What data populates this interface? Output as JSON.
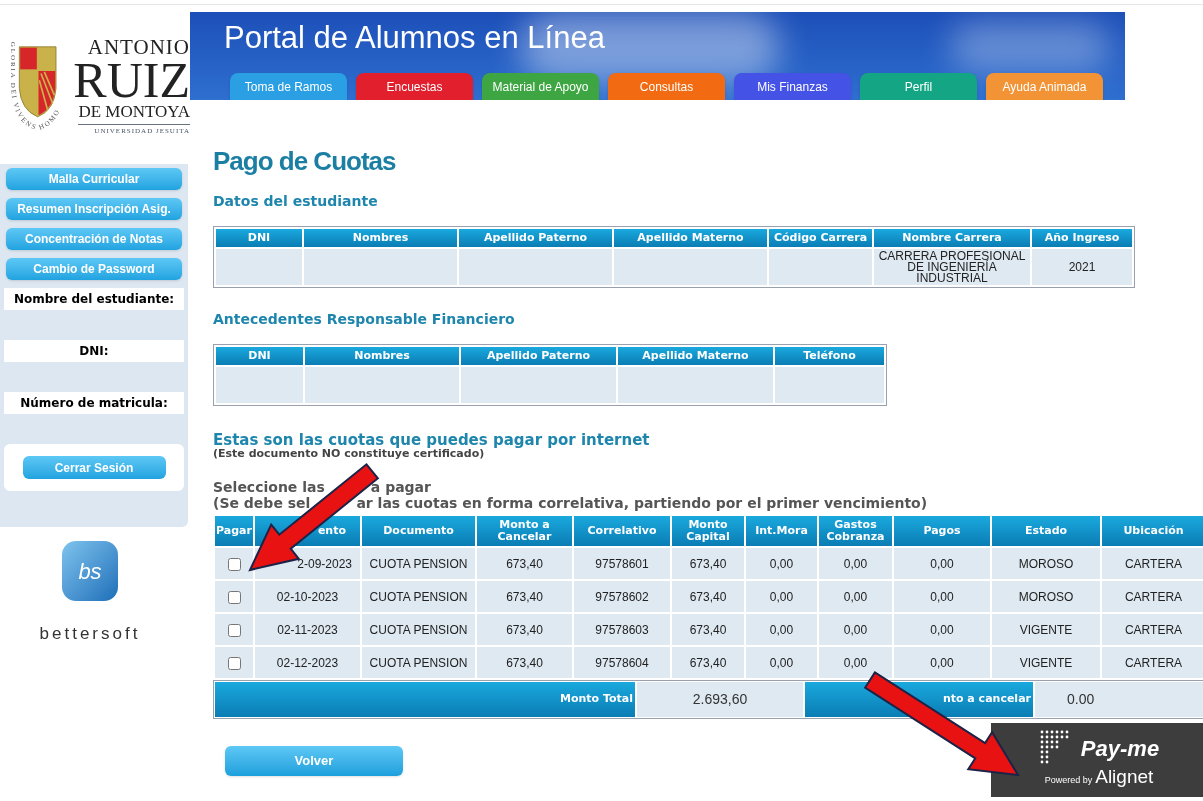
{
  "logo": {
    "motto": "GLORIA DEI VIVENS HOMO",
    "name_line_1": "ANTONIO",
    "name_line_2": "RUIZ",
    "name_line_3": "DE MONTOYA",
    "subtitle": "UNIVERSIDAD JESUITA"
  },
  "header": {
    "title": "Portal de Alumnos en Línea",
    "tabs": [
      {
        "label": "Toma de Ramos",
        "color": "#2b9fe3"
      },
      {
        "label": "Encuestas",
        "color": "#e11f2d"
      },
      {
        "label": "Material de Apoyo",
        "color": "#3da643"
      },
      {
        "label": "Consultas",
        "color": "#f26b12"
      },
      {
        "label": "Mis Finanzas",
        "color": "#4452e6"
      },
      {
        "label": "Perfil",
        "color": "#14a585"
      },
      {
        "label": "Ayuda Animada",
        "color": "#f29436"
      }
    ]
  },
  "sidebar": {
    "buttons": [
      "Malla Curricular",
      "Resumen Inscripción Asig.",
      "Concentración de Notas",
      "Cambio de Password"
    ],
    "fields": [
      {
        "label": "Nombre del estudiante:"
      },
      {
        "label": "DNI:"
      },
      {
        "label": "Número de matricula:"
      }
    ],
    "logout_button": "Cerrar Sesión"
  },
  "vendor_logo": {
    "cube_text": "bs",
    "name": "bettersoft"
  },
  "page_title": "Pago de Cuotas",
  "student_section": {
    "heading": "Datos del estudiante",
    "table": {
      "columns": [
        "DNI",
        "Nombres",
        "Apellido Paterno",
        "Apellido Materno",
        "Código Carrera",
        "Nombre Carrera",
        "Año Ingreso"
      ],
      "rows": [
        [
          "",
          "",
          "",
          "",
          "",
          "CARRERA PROFESIONAL DE INGENIERÍA INDUSTRIAL",
          "2021"
        ]
      ]
    }
  },
  "financial_section": {
    "heading": "Antecedentes Responsable Financiero",
    "table": {
      "columns": [
        "DNI",
        "Nombres",
        "Apellido Paterno",
        "Apellido Materno",
        "Teléfono"
      ],
      "rows": [
        [
          "",
          "",
          "",
          "",
          ""
        ]
      ]
    }
  },
  "payments_section": {
    "heading": "Estas son las cuotas que puedes pagar por internet",
    "note": "(Este documento NO constituye certificado)",
    "instruction_line_1": [
      "Seleccione las",
      "a pagar"
    ],
    "instruction_line_2": [
      "(Se debe sel",
      "ar las cuotas en forma correlativa, partiendo por el primer vencimiento)"
    ],
    "table": {
      "columns": [
        "Pagar",
        "ento",
        "Documento",
        "Monto a Cancelar",
        "Correlativo",
        "Monto Capital",
        "Int.Mora",
        "Gastos Cobranza",
        "Pagos",
        "Estado",
        "Ubicación"
      ],
      "rows": [
        {
          "checked": false,
          "cells": [
            "",
            "2-09-2023",
            "CUOTA PENSION",
            "673,40",
            "97578601",
            "673,40",
            "0,00",
            "0,00",
            "0,00",
            "MOROSO",
            "CARTERA"
          ]
        },
        {
          "checked": false,
          "cells": [
            "",
            "02-10-2023",
            "CUOTA PENSION",
            "673,40",
            "97578602",
            "673,40",
            "0,00",
            "0,00",
            "0,00",
            "MOROSO",
            "CARTERA"
          ]
        },
        {
          "checked": false,
          "cells": [
            "",
            "02-11-2023",
            "CUOTA PENSION",
            "673,40",
            "97578603",
            "673,40",
            "0,00",
            "0,00",
            "0,00",
            "VIGENTE",
            "CARTERA"
          ]
        },
        {
          "checked": false,
          "cells": [
            "",
            "02-12-2023",
            "CUOTA PENSION",
            "673,40",
            "97578604",
            "673,40",
            "0,00",
            "0,00",
            "0,00",
            "VIGENTE",
            "CARTERA"
          ]
        }
      ],
      "footer": {
        "total_label": "Monto Total",
        "total_value": "2.693,60",
        "cancel_label": "nto a cancelar",
        "cancel_value": "0.00"
      }
    }
  },
  "back_button": "Volver",
  "payment_badge": {
    "brand": "Pay-me",
    "powered_by": "Powered by",
    "provider": "Alignet"
  }
}
